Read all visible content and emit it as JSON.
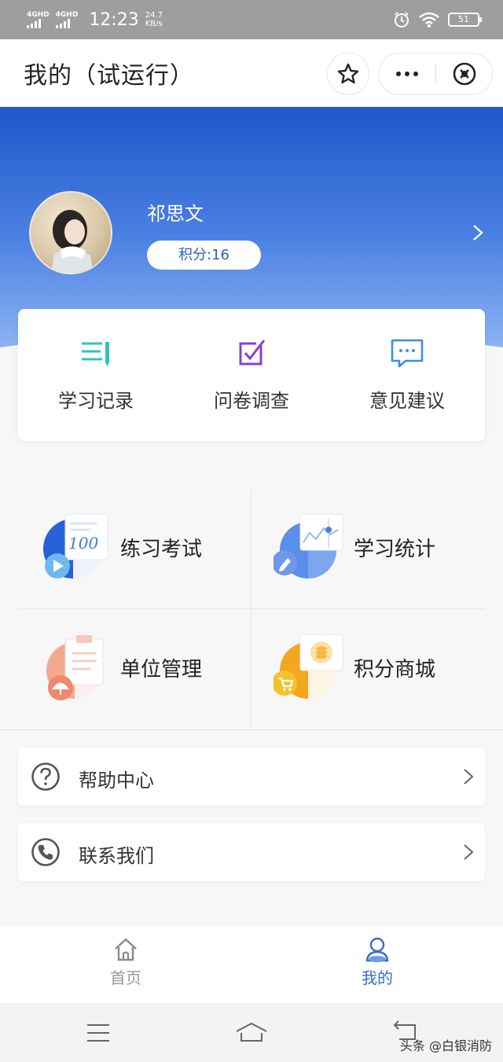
{
  "status_bar": {
    "network_1": "4GHD",
    "network_2": "4GHD",
    "time": "12:23",
    "speed_value": "24.7",
    "speed_unit": "KB/s",
    "battery": "51"
  },
  "nav": {
    "title": "我的（试运行）"
  },
  "profile": {
    "name": "祁思文",
    "points": "积分:16"
  },
  "quick_actions": [
    {
      "label": "学习记录",
      "icon": "list-edit-icon",
      "color": "#2fc4c0"
    },
    {
      "label": "问卷调查",
      "icon": "checkbox-icon",
      "color": "#8a3fd6"
    },
    {
      "label": "意见建议",
      "icon": "chat-bubble-icon",
      "color": "#3b8de8"
    }
  ],
  "grid": [
    {
      "label": "练习考试",
      "icon": "practice-exam-icon"
    },
    {
      "label": "学习统计",
      "icon": "study-stats-icon"
    },
    {
      "label": "单位管理",
      "icon": "unit-management-icon"
    },
    {
      "label": "积分商城",
      "icon": "points-mall-icon"
    }
  ],
  "list": [
    {
      "label": "帮助中心",
      "icon": "help-icon"
    },
    {
      "label": "联系我们",
      "icon": "phone-icon"
    }
  ],
  "tabs": [
    {
      "label": "首页",
      "icon": "home-icon",
      "active": false
    },
    {
      "label": "我的",
      "icon": "user-icon",
      "active": true
    }
  ],
  "colors": {
    "accent": "#2d5fc4",
    "tab_active": "#3a6cc8",
    "tab_inactive": "#999999"
  },
  "watermark": "头条 @白银消防"
}
